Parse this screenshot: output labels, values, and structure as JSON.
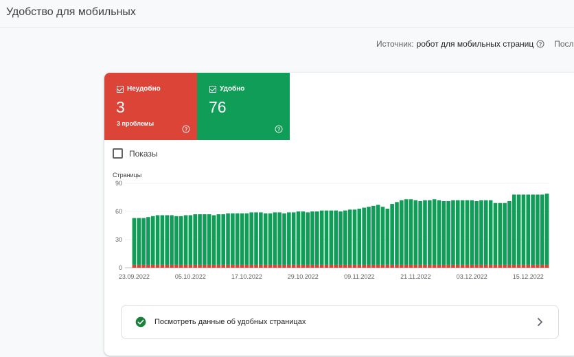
{
  "page": {
    "title": "Удобство для мобильных"
  },
  "source": {
    "label": "Источник:",
    "value": "робот для мобильных страниц",
    "help_icon": "help-circle-icon",
    "last_label": "Послед"
  },
  "tiles": {
    "bad": {
      "label": "Неудобно",
      "count": "3",
      "subtitle": "3 проблемы",
      "color": "#db4437",
      "checked": true
    },
    "good": {
      "label": "Удобно",
      "count": "76",
      "subtitle": "",
      "color": "#0f9d58",
      "checked": true
    }
  },
  "impressions": {
    "label": "Показы",
    "checked": false
  },
  "chart_data": {
    "type": "bar",
    "stacked": true,
    "ylabel": "Страницы",
    "ylim": [
      0,
      90
    ],
    "yticks": [
      0,
      30,
      60,
      90
    ],
    "grid": true,
    "x_tick_labels": [
      "23.09.2022",
      "05.10.2022",
      "17.10.2022",
      "29.10.2022",
      "09.11.2022",
      "21.11.2022",
      "03.12.2022",
      "15.12.2022"
    ],
    "x_tick_indices": [
      0,
      12,
      24,
      36,
      48,
      60,
      72,
      84
    ],
    "series": [
      {
        "name": "Неудобно",
        "color": "#db4437",
        "values": [
          3,
          3,
          3,
          3,
          3,
          3,
          3,
          3,
          3,
          3,
          3,
          3,
          3,
          3,
          3,
          3,
          3,
          3,
          3,
          3,
          3,
          3,
          3,
          3,
          3,
          3,
          3,
          3,
          3,
          3,
          3,
          3,
          3,
          3,
          3,
          3,
          3,
          3,
          3,
          3,
          3,
          3,
          3,
          3,
          3,
          3,
          3,
          3,
          3,
          3,
          3,
          3,
          3,
          3,
          3,
          3,
          3,
          3,
          3,
          3,
          3,
          3,
          3,
          3,
          3,
          3,
          3,
          3,
          3,
          3,
          3,
          3,
          3,
          3,
          3,
          3,
          3,
          3,
          3,
          3,
          3,
          3,
          3,
          3,
          3,
          3,
          3,
          3,
          3
        ]
      },
      {
        "name": "Удобно",
        "color": "#0f9d58",
        "values": [
          50,
          50,
          50,
          51,
          52,
          53,
          53,
          53,
          53,
          52,
          52,
          53,
          53,
          54,
          54,
          54,
          54,
          53,
          54,
          54,
          55,
          55,
          55,
          55,
          55,
          56,
          56,
          56,
          55,
          55,
          56,
          56,
          55,
          56,
          56,
          57,
          57,
          56,
          57,
          57,
          58,
          58,
          58,
          58,
          57,
          58,
          59,
          59,
          60,
          61,
          62,
          63,
          64,
          62,
          60,
          65,
          67,
          69,
          70,
          70,
          69,
          68,
          69,
          69,
          70,
          69,
          68,
          68,
          69,
          69,
          69,
          69,
          69,
          68,
          69,
          69,
          69,
          66,
          66,
          66,
          68,
          75,
          75,
          75,
          75,
          75,
          75,
          75,
          76
        ]
      }
    ]
  },
  "link": {
    "label": "Посмотреть данные об удобных страницах",
    "icon": "check-circle-icon",
    "chevron_icon": "chevron-right-icon"
  }
}
